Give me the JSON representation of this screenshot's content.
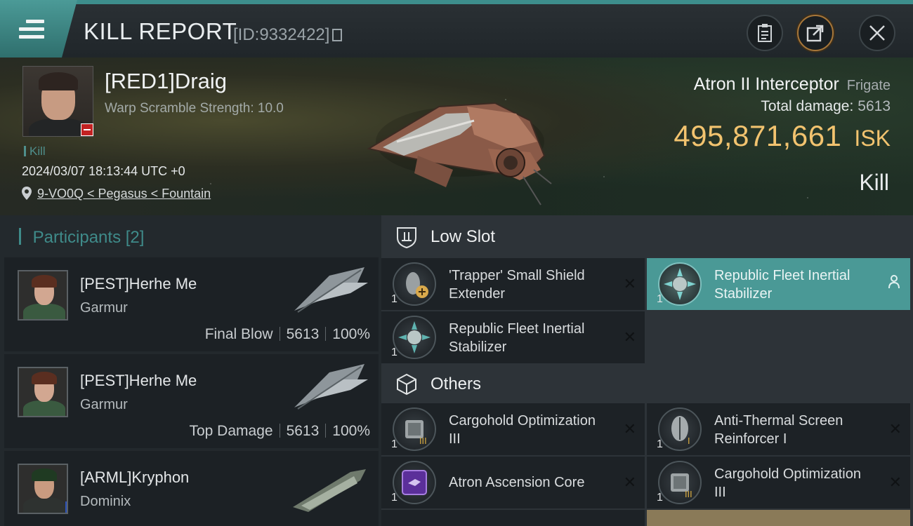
{
  "header": {
    "title": "KILL REPORT",
    "report_id": "[ID:9332422]"
  },
  "victim": {
    "name": "[RED1]Draig",
    "warp_scramble": "Warp Scramble Strength: 10.0",
    "tag": "Kill",
    "datetime": "2024/03/07 18:13:44 UTC +0",
    "location": "9-VO0Q < Pegasus < Fountain",
    "ship_name": "Atron II Interceptor",
    "ship_class": "Frigate",
    "total_damage_label": "Total damage:",
    "total_damage_value": "5613",
    "isk_amount": "495,871,661",
    "isk_unit": "ISK",
    "result": "Kill"
  },
  "participants": {
    "label": "Participants",
    "count": "[2]",
    "rows": [
      {
        "name": "[PEST]Herhe Me",
        "ship": "Garmur",
        "tag": "Final Blow",
        "damage": "5613",
        "percent": "100%"
      },
      {
        "name": "[PEST]Herhe Me",
        "ship": "Garmur",
        "tag": "Top Damage",
        "damage": "5613",
        "percent": "100%"
      },
      {
        "name": "[ARML]Kryphon",
        "ship": "Dominix"
      }
    ]
  },
  "fittings": {
    "low_slot_label": "Low Slot",
    "others_label": "Others",
    "low_slot": [
      {
        "qty": "1",
        "name": "'Trapper' Small Shield Extender"
      },
      {
        "qty": "1",
        "name": "Republic Fleet Inertial Stabilizer"
      },
      {
        "qty": "1",
        "name": "Republic Fleet Inertial Stabilizer"
      }
    ],
    "others": [
      {
        "qty": "1",
        "name": "Cargohold Optimization III"
      },
      {
        "qty": "1",
        "name": "Anti-Thermal Screen Reinforcer I"
      },
      {
        "qty": "1",
        "name": "Atron Ascension Core"
      },
      {
        "qty": "1",
        "name": "Cargohold Optimization III"
      }
    ]
  },
  "colors": {
    "accent": "#4a9996",
    "isk": "#f2c36f",
    "danger": "#c22222"
  },
  "icons": [
    "menu-icon",
    "clipboard-icon",
    "export-icon",
    "close-icon",
    "location-pin-icon",
    "shield-slot-icon",
    "cube-icon",
    "person-icon"
  ]
}
